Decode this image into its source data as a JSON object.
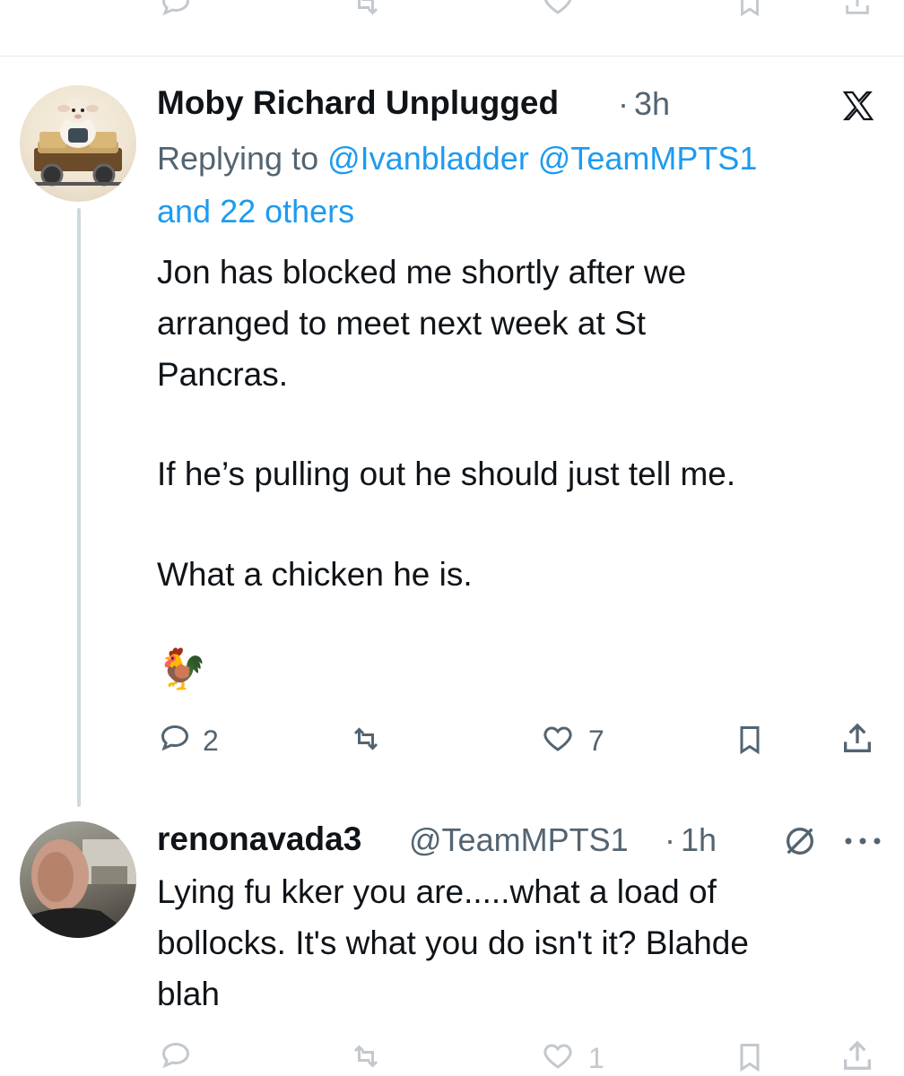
{
  "tweet1": {
    "display_name": "Moby Richard Unplugged",
    "time": "3h",
    "replying_label": "Replying to",
    "mentions": "@Ivanbladder @TeamMPTS1",
    "others": "and 22 others",
    "text_line1": "Jon has blocked me shortly after we",
    "text_line2": "arranged to meet next week at St",
    "text_line3": "Pancras.",
    "text_para2": "If he’s pulling out he should just tell me.",
    "text_para3": "What a chicken he is.",
    "emoji": "🐓",
    "reply_count": "2",
    "like_count": "7",
    "logo_icon": "x-logo-icon"
  },
  "tweet2": {
    "display_name": "renonavada3",
    "handle": "@TeamMPTS1",
    "time": "1h",
    "text_line1": "Lying fu kker you are.....what a load of",
    "text_line2": "bollocks. It's what you do isn't it? Blahde",
    "text_line3": "blah",
    "like_count": "1"
  },
  "separator": "·",
  "colors": {
    "link": "#1d9bf0",
    "muted": "#536471",
    "divider": "#e6e9eb",
    "thread_line": "#cfd9de"
  }
}
